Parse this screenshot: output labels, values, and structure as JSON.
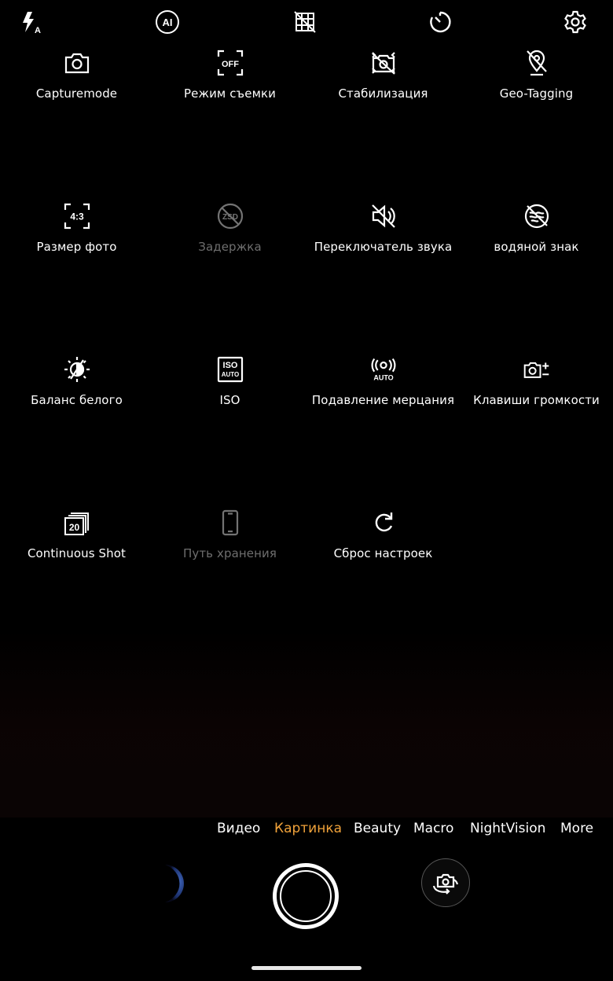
{
  "top_bar": {
    "icons": [
      "flash-auto-icon",
      "ai-icon",
      "grid-off-icon",
      "timer-icon",
      "settings-icon"
    ],
    "ai_label": "AI",
    "flash_sub": "A"
  },
  "settings_grid": [
    {
      "label": "Capturemode",
      "icon": "camera-icon",
      "enabled": true
    },
    {
      "label": "Режим съемки",
      "icon": "shooting-mode-off-icon",
      "enabled": true,
      "icon_text": "OFF"
    },
    {
      "label": "Стабилизация",
      "icon": "stabilization-off-icon",
      "enabled": true
    },
    {
      "label": "Geo-Tagging",
      "icon": "geotag-off-icon",
      "enabled": true
    },
    {
      "label": "Размер фото",
      "icon": "aspect-ratio-icon",
      "enabled": true,
      "icon_text": "4:3"
    },
    {
      "label": "Задержка",
      "icon": "zsd-off-icon",
      "enabled": false,
      "icon_text": "ZSD"
    },
    {
      "label": "Переключатель звука",
      "icon": "sound-off-icon",
      "enabled": true
    },
    {
      "label": "водяной знак",
      "icon": "watermark-off-icon",
      "enabled": true
    },
    {
      "label": "Баланс белого",
      "icon": "white-balance-icon",
      "enabled": true
    },
    {
      "label": "ISO",
      "icon": "iso-auto-icon",
      "enabled": true,
      "icon_text": "ISO",
      "icon_sub": "AUTO"
    },
    {
      "label": "Подавление мерцания",
      "icon": "anti-flicker-icon",
      "enabled": true,
      "icon_sub": "AUTO"
    },
    {
      "label": "Клавиши громкости",
      "icon": "volume-keys-icon",
      "enabled": true
    },
    {
      "label": "Continuous Shot",
      "icon": "burst-icon",
      "enabled": true,
      "icon_text": "20"
    },
    {
      "label": "Путь хранения",
      "icon": "storage-phone-icon",
      "enabled": false
    },
    {
      "label": "Сброс настроек",
      "icon": "reset-icon",
      "enabled": true
    }
  ],
  "modes": {
    "items": [
      "Видео",
      "Картинка",
      "Beauty",
      "Macro",
      "NightVision",
      "More"
    ],
    "active": "Картинка"
  },
  "colors": {
    "accent": "#f0a23a",
    "background": "#000000",
    "text": "#ffffff",
    "disabled": "#6e6e6e"
  }
}
